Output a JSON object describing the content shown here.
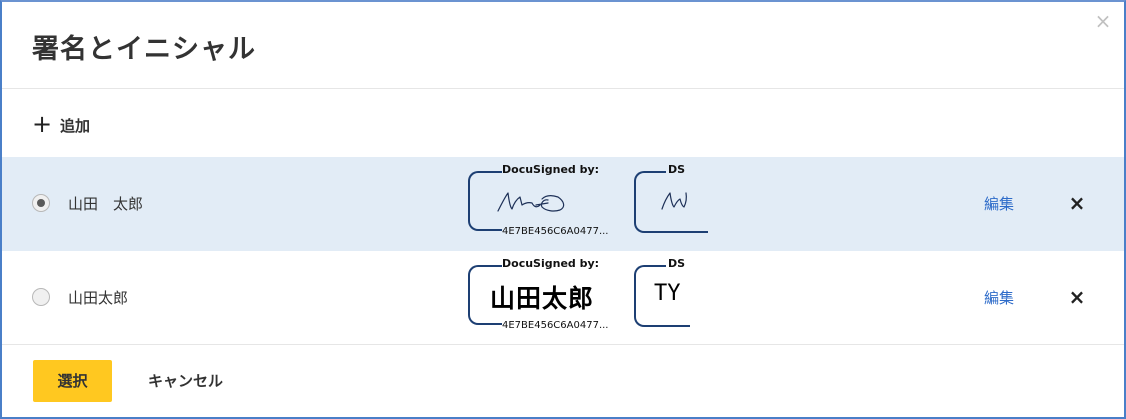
{
  "dialog": {
    "title": "署名とイニシャル",
    "close_glyph": "×"
  },
  "add": {
    "plus_glyph": "+",
    "label": "追加"
  },
  "signatures": [
    {
      "name": "山田　太郎",
      "selected": true,
      "signature_caption": "DocuSigned by:",
      "signature_kind": "handwritten",
      "hash": "4E7BE456C6A0477...",
      "initials_caption": "DS",
      "initials_kind": "handwritten",
      "edit_label": "編集",
      "delete_glyph": "×"
    },
    {
      "name": "山田太郎",
      "selected": false,
      "signature_caption": "DocuSigned by:",
      "signature_kind": "typed",
      "signature_text": "山田太郎",
      "hash": "4E7BE456C6A0477...",
      "initials_caption": "DS",
      "initials_kind": "typed",
      "initials_text": "TY",
      "edit_label": "編集",
      "delete_glyph": "×"
    }
  ],
  "footer": {
    "select_label": "選択",
    "cancel_label": "キャンセル"
  },
  "colors": {
    "accent_yellow": "#ffc820",
    "link_blue": "#2d6bc9",
    "selected_row": "#e2ecf6",
    "frame_blue": "#1d3f73"
  }
}
